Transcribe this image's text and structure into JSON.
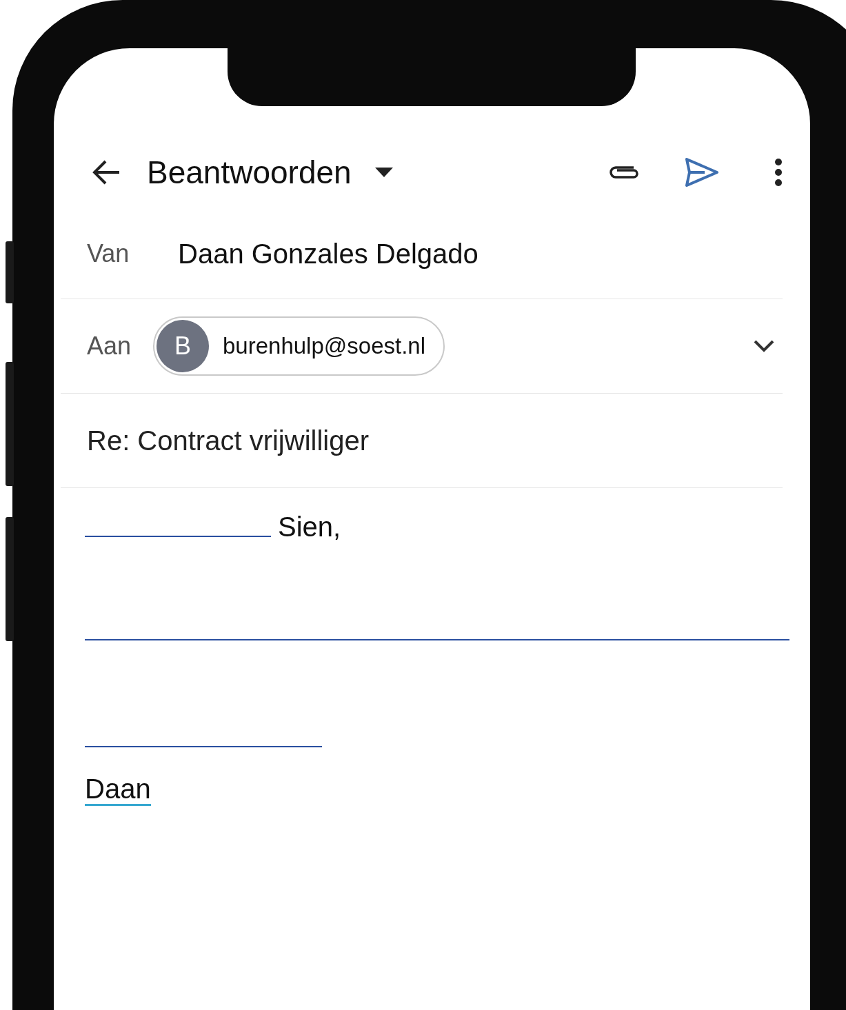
{
  "header": {
    "title": "Beantwoorden"
  },
  "from": {
    "label": "Van",
    "value": "Daan Gonzales Delgado"
  },
  "to": {
    "label": "Aan",
    "recipients": [
      {
        "initial": "B",
        "email": "burenhulp@soest.nl"
      }
    ]
  },
  "subject": "Re: Contract vrijwilliger",
  "body": [
    {
      "kind": "blank-then-text",
      "text": "Sien,"
    },
    {
      "kind": "full-blank"
    },
    {
      "kind": "short-blank"
    },
    {
      "kind": "signature",
      "text": "Daan"
    }
  ]
}
